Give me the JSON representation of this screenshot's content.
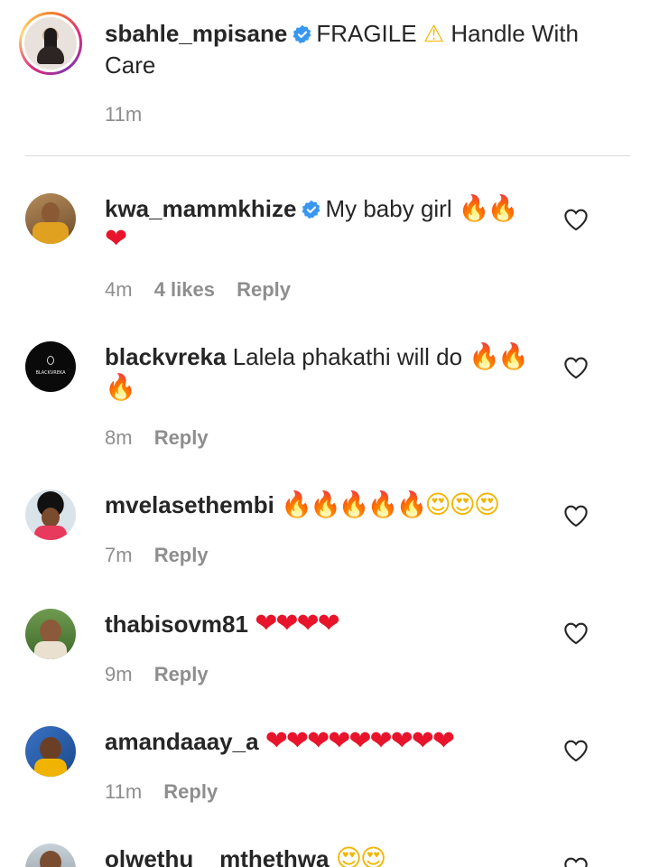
{
  "caption": {
    "username": "sbahle_mpisane",
    "text_before": "FRAGILE",
    "warning_emoji": "⚠",
    "text_after": "Handle With Care",
    "time": "11m",
    "verified": true
  },
  "comments": [
    {
      "username": "kwa_mammkhize",
      "verified": true,
      "text": "My baby girl",
      "emojis": "🔥🔥",
      "emojis_line2": "❤",
      "time": "4m",
      "likes": "4 likes",
      "reply": "Reply"
    },
    {
      "username": "blackvreka",
      "verified": false,
      "text": "Lalela phakathi will do",
      "emojis": "🔥🔥",
      "emojis_line2": "🔥",
      "time": "8m",
      "reply": "Reply",
      "avatar_text": "BLACKVREKA"
    },
    {
      "username": "mvelasethembi",
      "verified": false,
      "text": "",
      "emojis": "🔥🔥🔥🔥🔥",
      "emojis_b": "😍😍😍",
      "time": "7m",
      "reply": "Reply"
    },
    {
      "username": "thabisovm81",
      "verified": false,
      "text": "",
      "emojis": "❤❤❤❤",
      "time": "9m",
      "reply": "Reply"
    },
    {
      "username": "amandaaay_a",
      "verified": false,
      "text": "",
      "emojis": "❤❤❤❤❤❤❤❤❤",
      "time": "11m",
      "reply": "Reply"
    },
    {
      "username": "olwethu__mthethwa",
      "verified": false,
      "text": "",
      "emojis_b": "😍😍"
    }
  ],
  "icons": {
    "like": "heart-outline-icon",
    "verified": "verified-badge-icon"
  },
  "colors": {
    "verified_blue": "#3897f0",
    "meta_gray": "#8e8e8e",
    "text": "#262626"
  }
}
